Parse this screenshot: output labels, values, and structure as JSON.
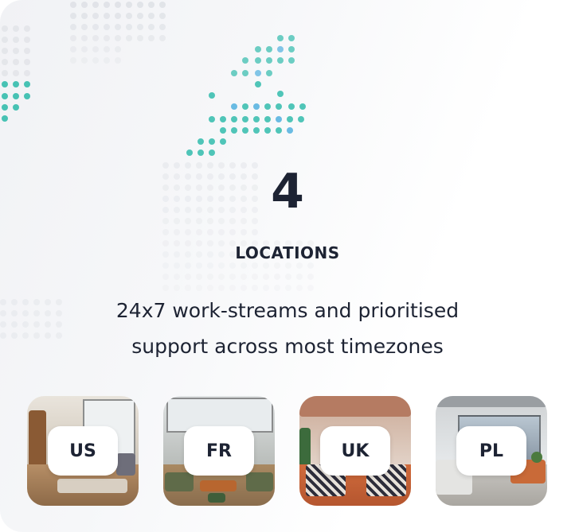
{
  "stat": {
    "number": "4",
    "label": "LOCATIONS"
  },
  "description": {
    "line1": "24x7 work-streams and prioritised",
    "line2": "support across most timezones"
  },
  "locations": [
    {
      "code": "US",
      "photo": "us-office-photo"
    },
    {
      "code": "FR",
      "photo": "fr-office-photo"
    },
    {
      "code": "UK",
      "photo": "uk-office-photo"
    },
    {
      "code": "PL",
      "photo": "pl-office-photo"
    }
  ],
  "colors": {
    "text": "#1d2333",
    "map_dot_grey": "#d7dae0",
    "map_dot_teal": "#3dbfb0",
    "map_dot_blue": "#5ab4e0"
  }
}
